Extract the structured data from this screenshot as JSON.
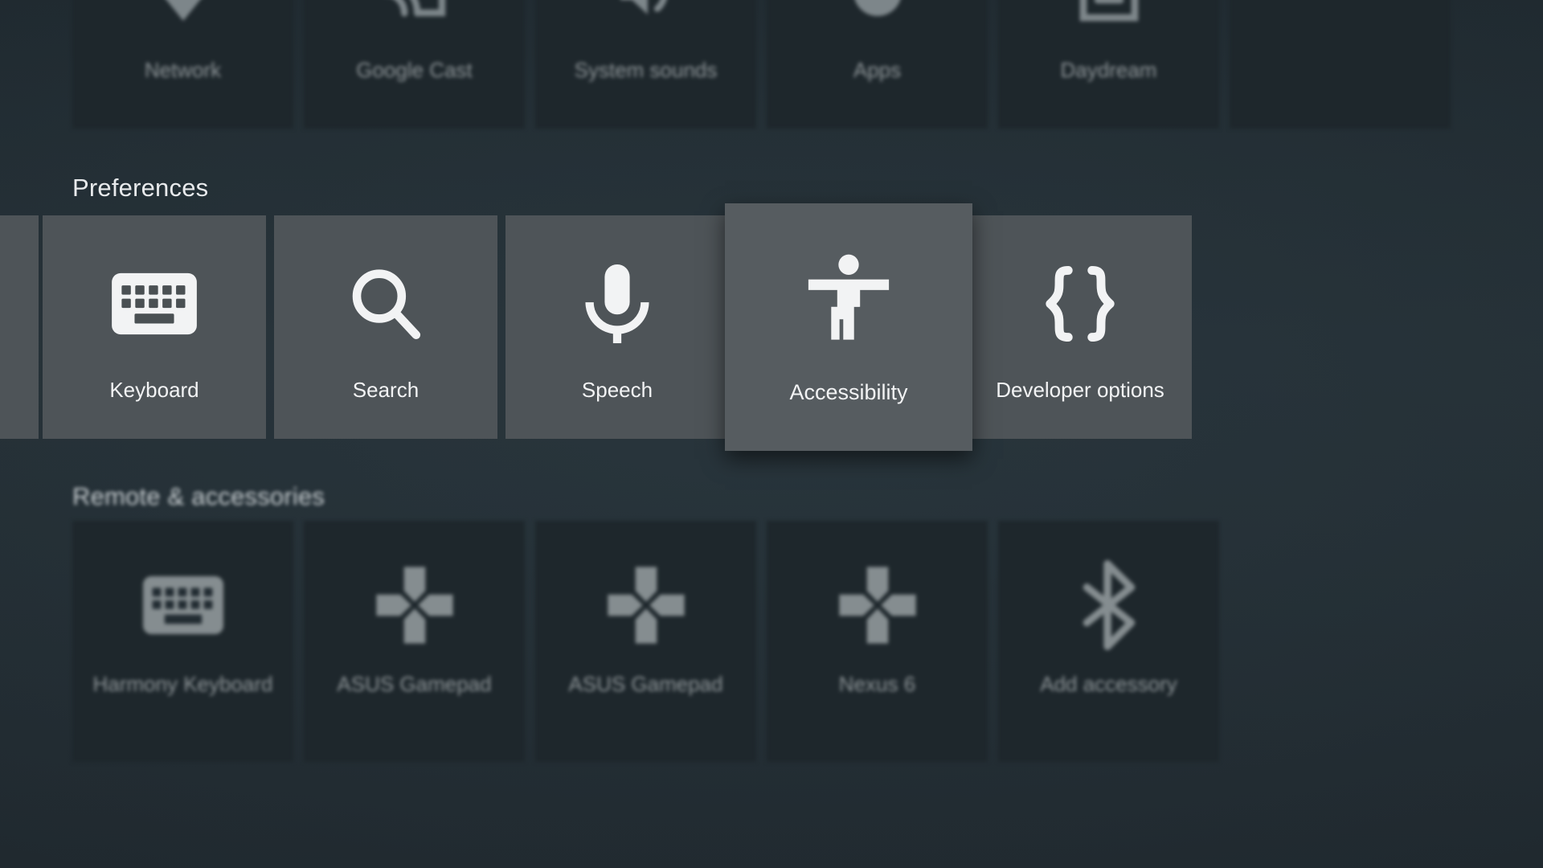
{
  "screen": {
    "app": "Android TV Settings",
    "background_color": "#222c32",
    "tile_color": "#4e5458",
    "tile_color_dim": "#1e272c",
    "focused_tile_color": "#565c60",
    "label_color": "#f2f3f4",
    "label_color_dim": "#8e9598"
  },
  "rows": [
    {
      "id": "device",
      "title": "",
      "focused": false,
      "tiles": [
        {
          "label": "Network",
          "icon": "wifi-icon"
        },
        {
          "label": "Google Cast",
          "icon": "cast-icon"
        },
        {
          "label": "System sounds",
          "icon": "volume-icon"
        },
        {
          "label": "Apps",
          "icon": "apps-circle-icon"
        },
        {
          "label": "Daydream",
          "icon": "daydream-icon"
        },
        {
          "label": "",
          "icon": "partial-tile-icon"
        }
      ]
    },
    {
      "id": "preferences",
      "title": "Preferences",
      "focused": true,
      "tiles": [
        {
          "label": "",
          "icon": "partial-tile-icon"
        },
        {
          "label": "Keyboard",
          "icon": "keyboard-icon"
        },
        {
          "label": "Search",
          "icon": "search-icon"
        },
        {
          "label": "Speech",
          "icon": "microphone-icon"
        },
        {
          "label": "Accessibility",
          "icon": "accessibility-icon"
        },
        {
          "label": "Developer options",
          "icon": "curly-braces-icon"
        }
      ],
      "selected_index": 4,
      "selected_label": "Accessibility"
    },
    {
      "id": "remote",
      "title": "Remote & accessories",
      "focused": false,
      "tiles": [
        {
          "label": "Harmony Keyboard",
          "icon": "keyboard-icon"
        },
        {
          "label": "ASUS Gamepad",
          "icon": "dpad-icon"
        },
        {
          "label": "ASUS Gamepad",
          "icon": "dpad-icon"
        },
        {
          "label": "Nexus 6",
          "icon": "dpad-icon"
        },
        {
          "label": "Add accessory",
          "icon": "bluetooth-icon"
        }
      ]
    }
  ]
}
